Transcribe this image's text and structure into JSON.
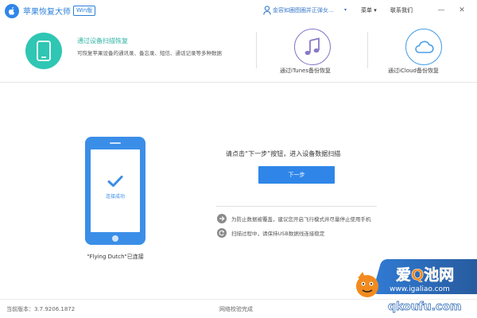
{
  "app": {
    "title": "苹果恢复大师",
    "version_badge": "Win版"
  },
  "titlebar": {
    "user_text": "金容如圈图圈并正弹女...",
    "menu_label": "菜单 ▾",
    "contact_label": "联系我们",
    "minimize_glyph": "—",
    "close_glyph": "✕"
  },
  "modes": {
    "device": {
      "title": "通过设备扫描恢复",
      "description": "可恢复苹果设备的通讯录、备忘录、短信、通话记录等多种数据"
    },
    "itunes": {
      "label": "通过iTunes备份恢复"
    },
    "icloud": {
      "label": "通过iCloud备份恢复"
    }
  },
  "device_panel": {
    "status": "连接成功",
    "caption": "\"Flying Dutch\"已连接"
  },
  "instructions": {
    "prompt": "请点击“下一步”按钮，进入设备数据扫描",
    "next_button": "下一步",
    "tips": [
      "为防止数据被覆盖，建议您开启飞行模式并尽量停止使用手机",
      "扫描过程中，请保持USB数据线连接稳定"
    ]
  },
  "footer": {
    "version": "当前版本：3.7.9206.1872",
    "status": "网络校验完成"
  },
  "watermark": {
    "text_main": "爱Q池网",
    "text_url": "www.igaliao.com",
    "text_sub": "qkoufu.com"
  },
  "colors": {
    "brand_blue": "#2f86e8",
    "teal": "#2fc6b4",
    "purple": "#8a78c8",
    "sky": "#4aa0e6"
  },
  "icons": {
    "logo": "apple-recovery-logo-icon",
    "user": "user-icon",
    "device_mode": "phone-icon",
    "itunes_mode": "music-note-icon",
    "icloud_mode": "cloud-icon",
    "tip_arrow": "arrow-right-icon",
    "tip_refresh": "refresh-icon"
  }
}
